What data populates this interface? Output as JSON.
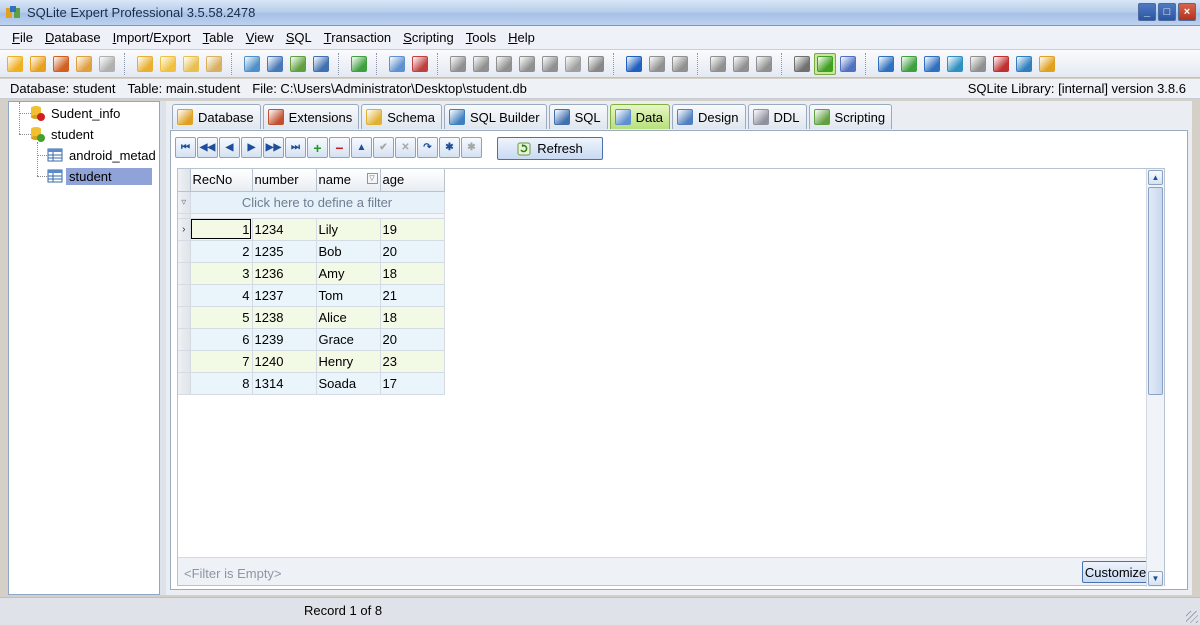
{
  "window": {
    "title": "SQLite Expert Professional 3.5.58.2478"
  },
  "menu": [
    {
      "u": "F",
      "rest": "ile"
    },
    {
      "u": "D",
      "rest": "atabase"
    },
    {
      "u": "I",
      "rest": "mport/Export"
    },
    {
      "u": "T",
      "rest": "able"
    },
    {
      "u": "V",
      "rest": "iew"
    },
    {
      "u": "S",
      "rest": "QL"
    },
    {
      "u": "T",
      "rest": "ransaction"
    },
    {
      "u": "S",
      "rest": "cripting"
    },
    {
      "u": "T",
      "rest": "ools"
    },
    {
      "u": "H",
      "rest": "elp"
    }
  ],
  "info": {
    "database": "Database: student",
    "table": "Table: main.student",
    "file": "File: C:\\Users\\Administrator\\Desktop\\student.db",
    "library": "SQLite Library: [internal] version 3.8.6"
  },
  "tree": {
    "items": [
      "Sudent_info",
      "student",
      "android_metad",
      "student"
    ]
  },
  "tabs": [
    "Database",
    "Extensions",
    "Schema",
    "SQL Builder",
    "SQL",
    "Data",
    "Design",
    "DDL",
    "Scripting"
  ],
  "active_tab": "Data",
  "toolbar": {
    "refresh": "Refresh",
    "customize": "Customize..."
  },
  "grid": {
    "columns": [
      "RecNo",
      "number",
      "name",
      "age"
    ],
    "filter_hint": "Click here to define a filter",
    "rows": [
      [
        "1",
        "1234",
        "Lily",
        "19"
      ],
      [
        "2",
        "1235",
        "Bob",
        "20"
      ],
      [
        "3",
        "1236",
        "Amy",
        "18"
      ],
      [
        "4",
        "1237",
        "Tom",
        "21"
      ],
      [
        "5",
        "1238",
        "Alice",
        "18"
      ],
      [
        "6",
        "1239",
        "Grace",
        "20"
      ],
      [
        "7",
        "1240",
        "Henry",
        "23"
      ],
      [
        "8",
        "1314",
        "Soada",
        "17"
      ]
    ],
    "filter_status": "<Filter is Empty>"
  },
  "status": {
    "record": "Record 1 of 8"
  },
  "colors": {
    "active_tab": "#b8e07a",
    "selected_tree": "#8fa3d8",
    "odd_row": "#f2f9e4",
    "even_row": "#e9f4fb"
  }
}
